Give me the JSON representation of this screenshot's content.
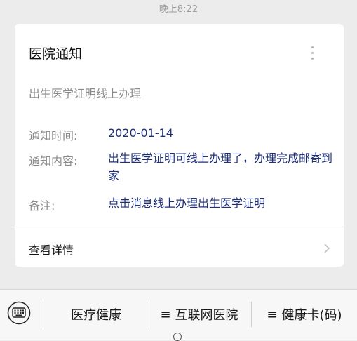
{
  "timestamp": "晚上8:22",
  "card": {
    "title": "医院通知",
    "subtitle": "出生医学证明线上办理",
    "fields": [
      {
        "label": "通知时间:",
        "value": "2020-01-14"
      },
      {
        "label": "通知内容:",
        "value": "出生医学证明可线上办理了，办理完成邮寄到家"
      },
      {
        "label": "备注:",
        "value": "点击消息线上办理出生医学证明"
      }
    ],
    "details_link": "查看详情"
  },
  "bottom_menu": {
    "keyboard_icon": "keyboard-icon",
    "items": [
      {
        "label": "医疗健康",
        "icon": ""
      },
      {
        "label": "互联网医院",
        "icon": "≡"
      },
      {
        "label": "健康卡(码)",
        "icon": "≡"
      }
    ]
  },
  "colors": {
    "page_bg": "#ececec",
    "card_bg": "#ffffff",
    "value_text": "#1d2f7a",
    "label_text": "#8a8a8a"
  }
}
